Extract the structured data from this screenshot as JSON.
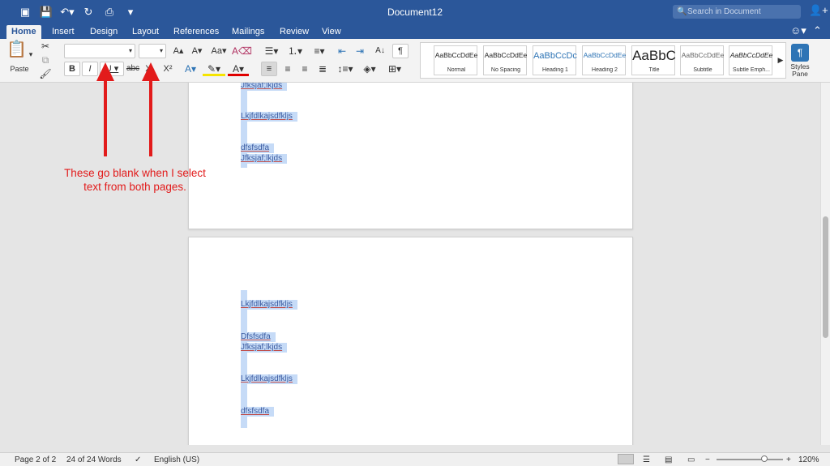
{
  "window": {
    "title": "Document12",
    "search_placeholder": "Search in Document"
  },
  "tabs": [
    "Home",
    "Insert",
    "Design",
    "Layout",
    "References",
    "Mailings",
    "Review",
    "View"
  ],
  "ribbon": {
    "paste_label": "Paste",
    "styles": [
      {
        "preview": "AaBbCcDdEe",
        "name": "Normal",
        "color": "#222222"
      },
      {
        "preview": "AaBbCcDdEe",
        "name": "No Spacing",
        "color": "#222222"
      },
      {
        "preview": "AaBbCcDc",
        "name": "Heading 1",
        "color": "#2e74b5"
      },
      {
        "preview": "AaBbCcDdEe",
        "name": "Heading 2",
        "color": "#2e74b5"
      },
      {
        "preview": "AaBbC",
        "name": "Title",
        "color": "#111111"
      },
      {
        "preview": "AaBbCcDdEe",
        "name": "Subtitle",
        "color": "#666666"
      },
      {
        "preview": "AaBbCcDdEe",
        "name": "Subtle Emph...",
        "color": "#444444"
      }
    ],
    "styles_pane_label": "Styles Pane",
    "font_name": "",
    "font_size": ""
  },
  "document": {
    "page1_lines": [
      "Jfksjaf;lkjds",
      "Lkjfdlkajsdfkljs",
      "dfsfsdfa",
      "Jfksjaf;lkjds"
    ],
    "page2_lines": [
      "Lkjfdlkajsdfkljs",
      "Dfsfsdfa",
      "Jfksjaf;lkjds",
      "Lkjfdlkajsdfkljs",
      "dfsfsdfa"
    ]
  },
  "annotation": {
    "text": "These go blank when I select text from both pages.",
    "color": "#e21b1b"
  },
  "status": {
    "page": "Page 2 of 2",
    "words": "24 of 24 Words",
    "language": "English (US)",
    "zoom": "120%",
    "zoom_level": 0.72
  }
}
